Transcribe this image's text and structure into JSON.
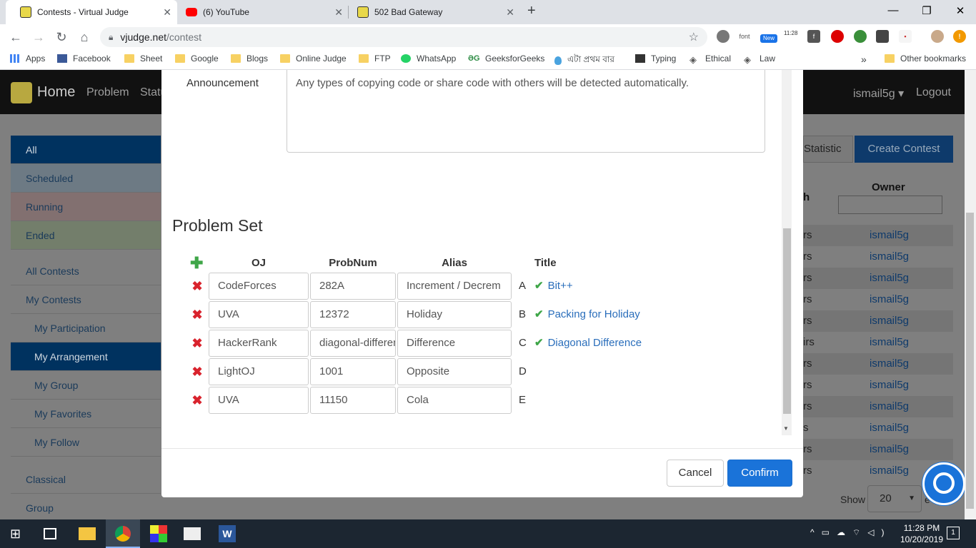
{
  "browser": {
    "tabs": [
      {
        "title": "Contests - Virtual Judge"
      },
      {
        "title": "(6) YouTube"
      },
      {
        "title": "502 Bad Gateway"
      }
    ],
    "url_host": "vjudge.net",
    "url_path": "/contest",
    "bookmarks": [
      "Apps",
      "Facebook",
      "Sheet",
      "Google",
      "Blogs",
      "Online Judge",
      "FTP",
      "WhatsApp",
      "GeeksforGeeks",
      "এটা প্রথম বার",
      "Typing",
      "Ethical",
      "Law",
      "Other bookmarks"
    ],
    "ext_labels": {
      "font": "font",
      "new": "New",
      "time": "11:28"
    }
  },
  "site": {
    "brand": "Home",
    "nav": [
      "Problem",
      "Statu"
    ],
    "user": "ismail5g ▾",
    "logout": "Logout",
    "left_menu": [
      "All",
      "Scheduled",
      "Running",
      "Ended",
      "All Contests",
      "My Contests",
      "My Participation",
      "My Arrangement",
      "My Group",
      "My Favorites",
      "My Follow",
      "Classical",
      "Group"
    ],
    "statistic": "Statistic",
    "create_contest": "Create Contest",
    "owner_header": "Owner",
    "owner_rows": [
      "ismail5g",
      "ismail5g",
      "ismail5g",
      "ismail5g",
      "ismail5g",
      "ismail5g",
      "ismail5g",
      "ismail5g",
      "ismail5g",
      "ismail5g",
      "ismail5g",
      "ismail5g"
    ],
    "length_frags": [
      "h",
      "rs",
      "rs",
      "rs",
      "rs",
      "rs",
      "irs",
      "rs",
      "rs",
      "rs",
      "s",
      "rs",
      "rs"
    ],
    "show_label": "Show",
    "show_value": "20",
    "show_suffix": "e"
  },
  "modal": {
    "announcement_label": "Announcement",
    "announcement_text": "Any types of  copying code or share code with others will be detected automatically.",
    "problem_set_title": "Problem Set",
    "headers": {
      "oj": "OJ",
      "probnum": "ProbNum",
      "alias": "Alias",
      "title": "Title"
    },
    "problems": [
      {
        "oj": "CodeForces",
        "probnum": "282A",
        "alias": "Increment / Decrem",
        "letter": "A",
        "title": "Bit++"
      },
      {
        "oj": "UVA",
        "probnum": "12372",
        "alias": "Holiday",
        "letter": "B",
        "title": "Packing for Holiday"
      },
      {
        "oj": "HackerRank",
        "probnum": "diagonal-difference",
        "alias": "Difference",
        "letter": "C",
        "title": "Diagonal Difference"
      },
      {
        "oj": "LightOJ",
        "probnum": "1001",
        "alias": "Opposite",
        "letter": "D",
        "title": ""
      },
      {
        "oj": "UVA",
        "probnum": "11150",
        "alias": "Cola",
        "letter": "E",
        "title": ""
      }
    ],
    "cancel": "Cancel",
    "confirm": "Confirm"
  },
  "taskbar": {
    "time": "11:28 PM",
    "date": "10/20/2019",
    "notif": "1"
  },
  "colors": {
    "accent": "#1a73d9",
    "delete": "#d9232d",
    "check": "#3fa648",
    "link": "#2a6ebb"
  }
}
